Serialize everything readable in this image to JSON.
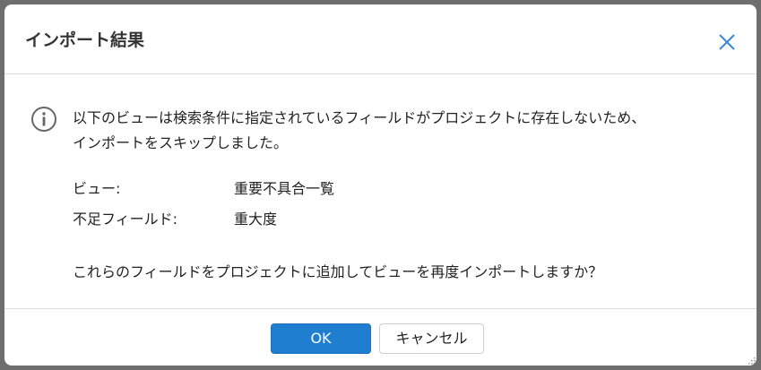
{
  "dialog": {
    "title": "インポート結果",
    "close_icon": "close-icon",
    "accent_color": "#1f7ed0"
  },
  "message": {
    "icon": "info-circle-icon",
    "line1": "以下のビューは検索条件に指定されているフィールドがプロジェクトに存在しないため、",
    "line2": "インポートをスキップしました。"
  },
  "details": [
    {
      "label": "ビュー:",
      "value": "重要不具合一覧"
    },
    {
      "label": "不足フィールド:",
      "value": "重大度"
    }
  ],
  "question": "これらのフィールドをプロジェクトに追加してビューを再度インポートしますか？",
  "buttons": {
    "ok": "OK",
    "cancel": "キャンセル"
  }
}
